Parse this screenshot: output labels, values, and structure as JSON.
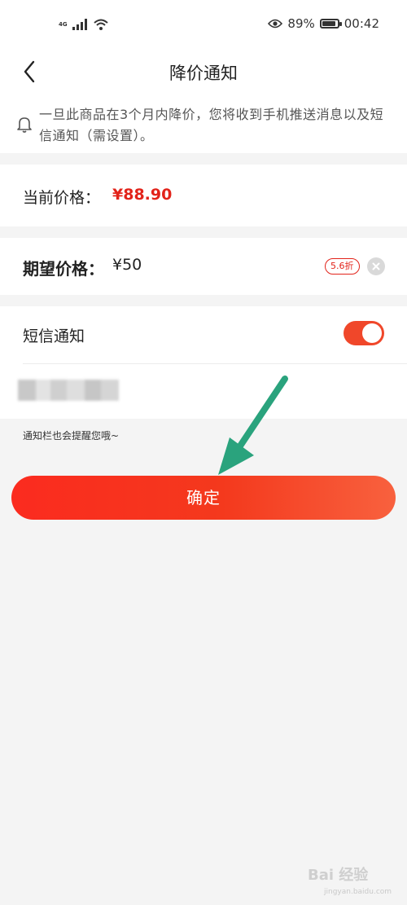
{
  "status_bar": {
    "network": "4G",
    "battery_percent": "89%",
    "battery_level": 0.89,
    "time": "00:42",
    "icons": [
      "signal-icon",
      "wifi-icon",
      "eye-icon",
      "battery-icon"
    ]
  },
  "header": {
    "title": "降价通知",
    "back_icon": "chevron-left-icon"
  },
  "notice": {
    "icon": "bell-icon",
    "text": "一旦此商品在3个月内降价，您将收到手机推送消息以及短信通知（需设置）。"
  },
  "current_price": {
    "label": "当前价格：",
    "value": "¥88.90"
  },
  "expected_price": {
    "label": "期望价格：",
    "value": "¥50",
    "discount": "5.6折",
    "clear_icon": "clear-icon"
  },
  "sms": {
    "label": "短信通知",
    "enabled": true
  },
  "hint": "通知栏也会提醒您哦~",
  "confirm_label": "确定",
  "colors": {
    "accent": "#f0472a",
    "price": "#e2231a",
    "arrow": "#2aa37d"
  },
  "watermark": {
    "name": "Bai 经验",
    "url": "jingyan.baidu.com"
  }
}
